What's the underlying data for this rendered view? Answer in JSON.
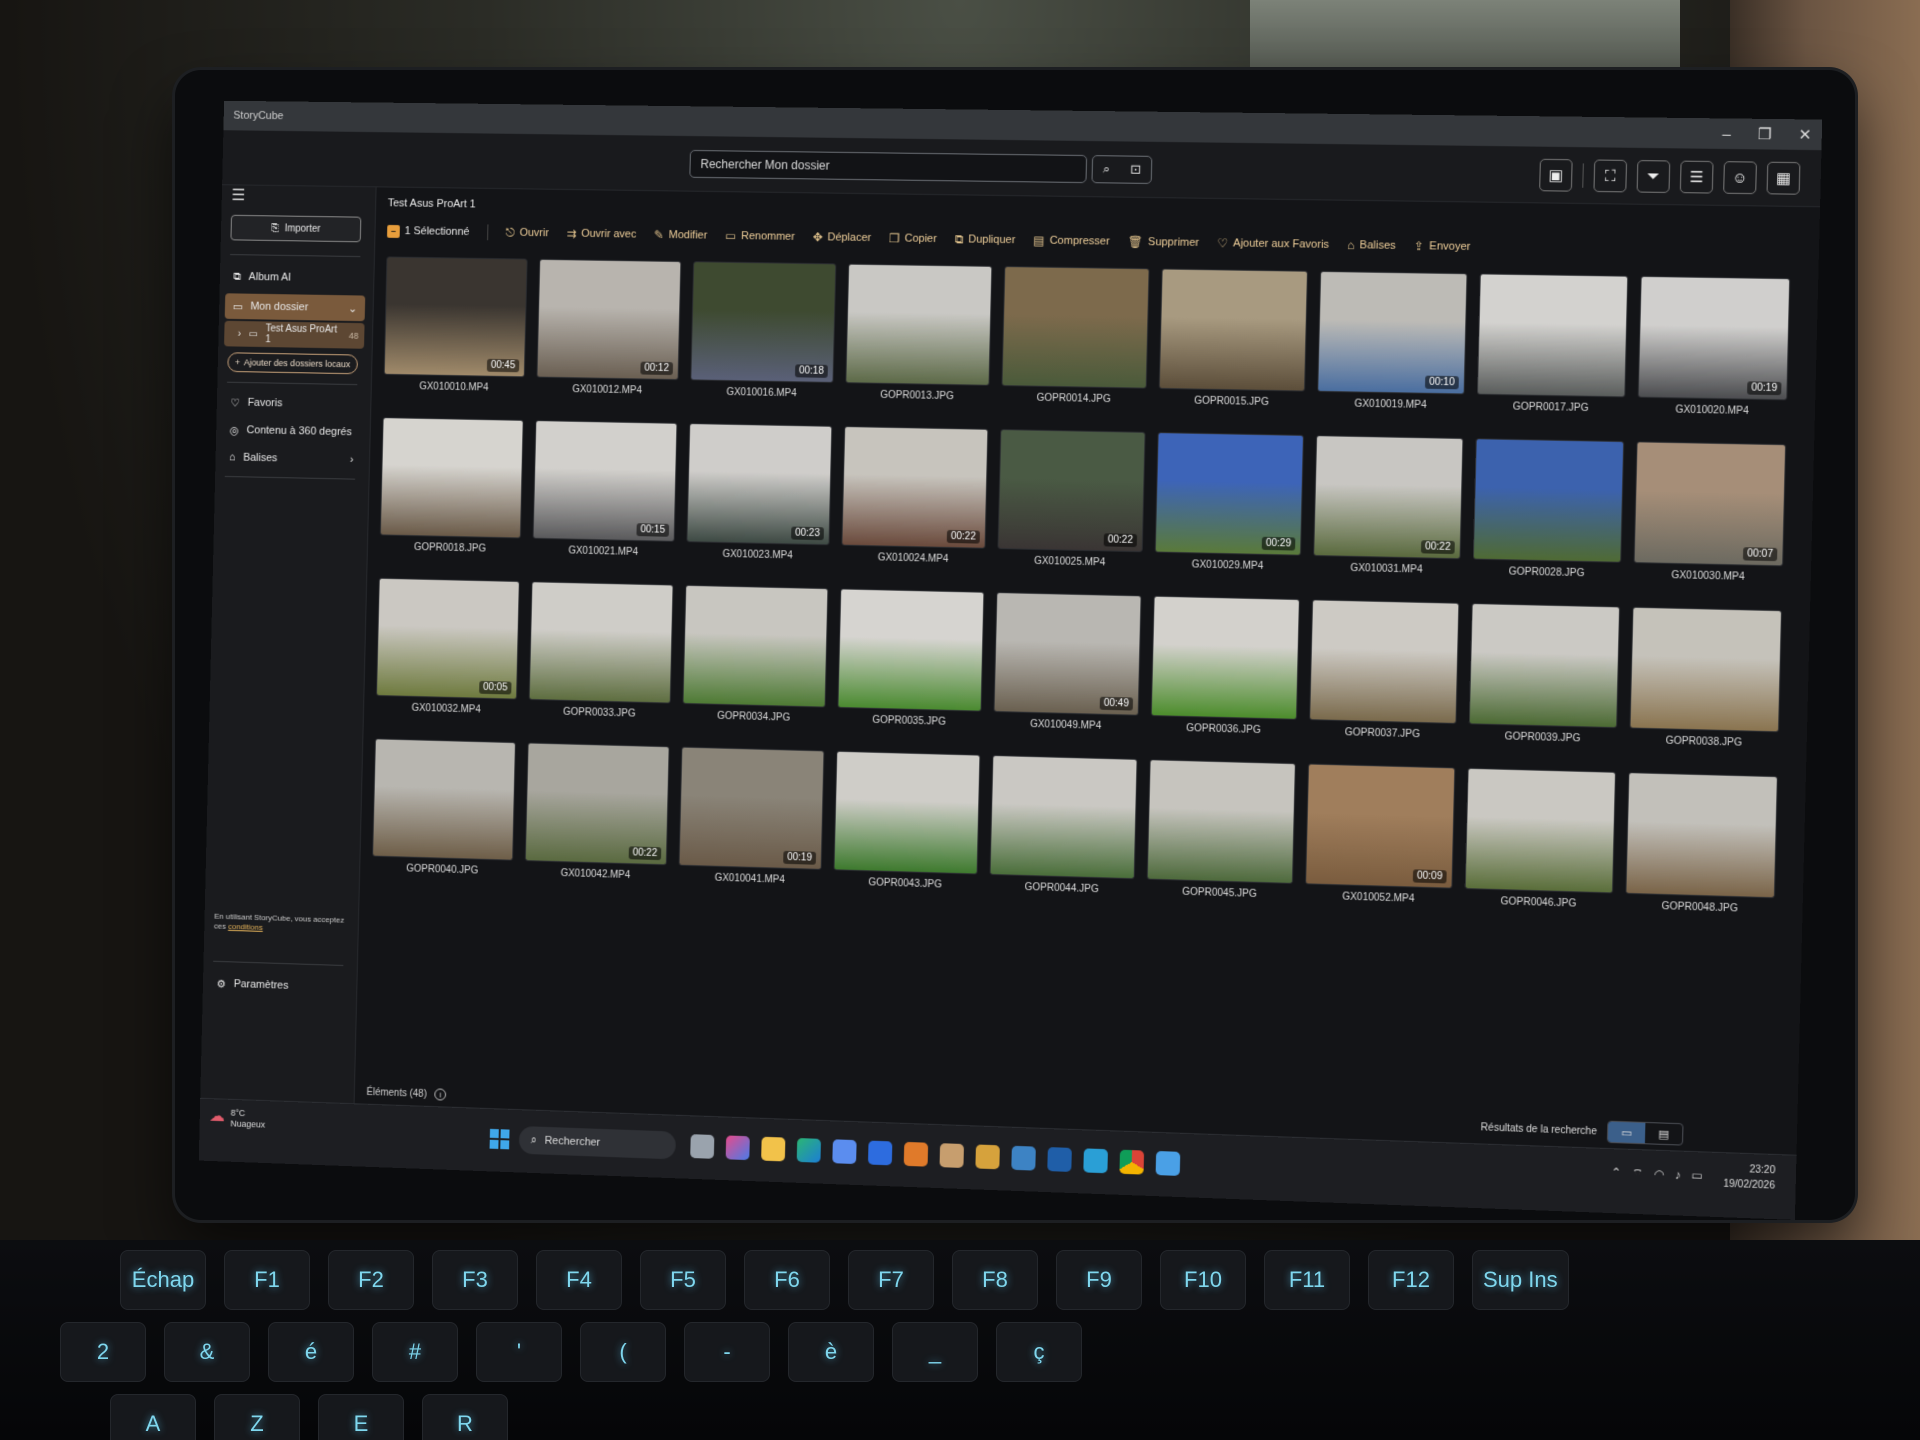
{
  "window": {
    "title": "StoryCube",
    "controls": [
      "–",
      "❐",
      "✕"
    ]
  },
  "search": {
    "placeholder": "Rechercher Mon dossier"
  },
  "sidebar": {
    "import_label": "Importer",
    "items": [
      {
        "label": "Album AI",
        "icon": "ai-album-icon"
      },
      {
        "label": "Mon dossier",
        "icon": "folder-icon",
        "active": true
      },
      {
        "label": "Test Asus ProArt 1",
        "icon": "folder-icon",
        "count": "48"
      },
      {
        "label": "Favoris",
        "icon": "heart-icon"
      },
      {
        "label": "Contenu à 360 degrés",
        "icon": "360-icon"
      },
      {
        "label": "Balises",
        "icon": "tag-icon"
      }
    ],
    "add_local_folders": "Ajouter des dossiers locaux",
    "terms_prefix": "En utilisant StoryCube, vous acceptez ces",
    "terms_link": "conditions",
    "settings": "Paramètres"
  },
  "main": {
    "folder_title": "Test Asus ProArt 1",
    "selected": "1 Sélectionné",
    "actions": [
      {
        "label": "Ouvrir",
        "icon": "open-icon"
      },
      {
        "label": "Ouvrir avec",
        "icon": "open-with-icon"
      },
      {
        "label": "Modifier",
        "icon": "edit-icon"
      },
      {
        "label": "Renommer",
        "icon": "rename-icon"
      },
      {
        "label": "Déplacer",
        "icon": "move-icon"
      },
      {
        "label": "Copier",
        "icon": "copy-icon"
      },
      {
        "label": "Dupliquer",
        "icon": "duplicate-icon"
      },
      {
        "label": "Compresser",
        "icon": "compress-icon"
      },
      {
        "label": "Supprimer",
        "icon": "trash-icon"
      },
      {
        "label": "Ajouter aux Favoris",
        "icon": "heart-icon"
      },
      {
        "label": "Balises",
        "icon": "tag-icon"
      },
      {
        "label": "Envoyer",
        "icon": "share-icon"
      }
    ],
    "items": [
      {
        "name": "GX010010.MP4",
        "duration": "00:45",
        "c1": "#3a3530",
        "c2": "#a08a6a"
      },
      {
        "name": "GX010012.MP4",
        "duration": "00:12",
        "c1": "#b8b4ae",
        "c2": "#6a5f52"
      },
      {
        "name": "GX010016.MP4",
        "duration": "00:18",
        "c1": "#3e4a30",
        "c2": "#5a6078"
      },
      {
        "name": "GOPR0013.JPG",
        "duration": "",
        "c1": "#c9c8c4",
        "c2": "#5d6a48"
      },
      {
        "name": "GOPR0014.JPG",
        "duration": "",
        "c1": "#7d6a4c",
        "c2": "#4a5a3a"
      },
      {
        "name": "GOPR0015.JPG",
        "duration": "",
        "c1": "#a89a80",
        "c2": "#5c4e3a"
      },
      {
        "name": "GX010019.MP4",
        "duration": "00:10",
        "c1": "#bdbbb6",
        "c2": "#4a6ea0"
      },
      {
        "name": "GOPR0017.JPG",
        "duration": "",
        "c1": "#d3d2cf",
        "c2": "#5a5d5c"
      },
      {
        "name": "GX010020.MP4",
        "duration": "00:19",
        "c1": "#d0cfcd",
        "c2": "#4c4d50"
      },
      {
        "name": "GOPR0018.JPG",
        "duration": "",
        "c1": "#d6d4cf",
        "c2": "#6a5a48"
      },
      {
        "name": "GX010021.MP4",
        "duration": "00:15",
        "c1": "#d2d0cc",
        "c2": "#5a5a5c"
      },
      {
        "name": "GX010023.MP4",
        "duration": "00:23",
        "c1": "#cfcdca",
        "c2": "#3e4a44"
      },
      {
        "name": "GX010024.MP4",
        "duration": "00:22",
        "c1": "#c7c4bd",
        "c2": "#6a4a3c"
      },
      {
        "name": "GX010025.MP4",
        "duration": "00:22",
        "c1": "#4a5a44",
        "c2": "#3a3534"
      },
      {
        "name": "GX010029.MP4",
        "duration": "00:29",
        "c1": "#3d64b8",
        "c2": "#5a7a3a"
      },
      {
        "name": "GX010031.MP4",
        "duration": "00:22",
        "c1": "#c8c6c2",
        "c2": "#5a6a3e"
      },
      {
        "name": "GOPR0028.JPG",
        "duration": "",
        "c1": "#3c62ae",
        "c2": "#4f6a34"
      },
      {
        "name": "GX010030.MP4",
        "duration": "00:07",
        "c1": "#a68e78",
        "c2": "#6c6a60"
      },
      {
        "name": "GX010032.MP4",
        "duration": "00:05",
        "c1": "#cbc8c2",
        "c2": "#6e7a3e"
      },
      {
        "name": "GOPR0033.JPG",
        "duration": "",
        "c1": "#cfcdc8",
        "c2": "#5e6e40"
      },
      {
        "name": "GOPR0034.JPG",
        "duration": "",
        "c1": "#c8c6c0",
        "c2": "#4e7a34"
      },
      {
        "name": "GOPR0035.JPG",
        "duration": "",
        "c1": "#d6d4d0",
        "c2": "#4a8a30"
      },
      {
        "name": "GX010049.MP4",
        "duration": "00:49",
        "c1": "#b9b7b2",
        "c2": "#6a6050"
      },
      {
        "name": "GOPR0036.JPG",
        "duration": "",
        "c1": "#d3d1cc",
        "c2": "#4c8c2c"
      },
      {
        "name": "GOPR0037.JPG",
        "duration": "",
        "c1": "#cdcac4",
        "c2": "#7a6a4c"
      },
      {
        "name": "GOPR0039.JPG",
        "duration": "",
        "c1": "#cbc9c4",
        "c2": "#4c6a34"
      },
      {
        "name": "GOPR0038.JPG",
        "duration": "",
        "c1": "#c5c2ba",
        "c2": "#8a7450"
      },
      {
        "name": "GOPR0040.JPG",
        "duration": "",
        "c1": "#b8b6b0",
        "c2": "#6e5e48"
      },
      {
        "name": "GX010042.MP4",
        "duration": "00:22",
        "c1": "#a8a69e",
        "c2": "#5a6a40"
      },
      {
        "name": "GX010041.MP4",
        "duration": "00:19",
        "c1": "#8a8478",
        "c2": "#6a5a48"
      },
      {
        "name": "GOPR0043.JPG",
        "duration": "",
        "c1": "#cfcdc8",
        "c2": "#3e7a2e"
      },
      {
        "name": "GOPR0044.JPG",
        "duration": "",
        "c1": "#cac8c3",
        "c2": "#4a6e3a"
      },
      {
        "name": "GOPR0045.JPG",
        "duration": "",
        "c1": "#c6c4be",
        "c2": "#4e6a3c"
      },
      {
        "name": "GX010052.MP4",
        "duration": "00:09",
        "c1": "#a07e5c",
        "c2": "#7a5c3e"
      },
      {
        "name": "GOPR0046.JPG",
        "duration": "",
        "c1": "#cac8c2",
        "c2": "#5a6e3a"
      },
      {
        "name": "GOPR0048.JPG",
        "duration": "",
        "c1": "#c2c0ba",
        "c2": "#7a6448"
      }
    ],
    "status": "Éléments (48)"
  },
  "taskbar": {
    "weather_temp": "8°C",
    "weather_desc": "Nuageux",
    "search_label": "Rechercher",
    "time": "23:20",
    "date": "19/02/2026",
    "search_results_label": "Résultats de la recherche"
  },
  "keyboard": {
    "row1": [
      "Échap",
      "F1",
      "F2",
      "F3",
      "F4",
      "F5",
      "F6",
      "F7",
      "F8",
      "F9",
      "F10",
      "F11",
      "F12",
      "Sup Ins"
    ],
    "row2": [
      "2",
      "&",
      "é",
      "#",
      "'",
      "(",
      "-",
      "è",
      "_",
      "ç"
    ],
    "row3": [
      "A",
      "Z",
      "E",
      "R"
    ]
  },
  "colors": {
    "accent": "#e89e3c",
    "action_text": "#efcf9a",
    "sidebar_active": "#7a5a3c",
    "keyboard_glow": "#7fd7ee"
  }
}
